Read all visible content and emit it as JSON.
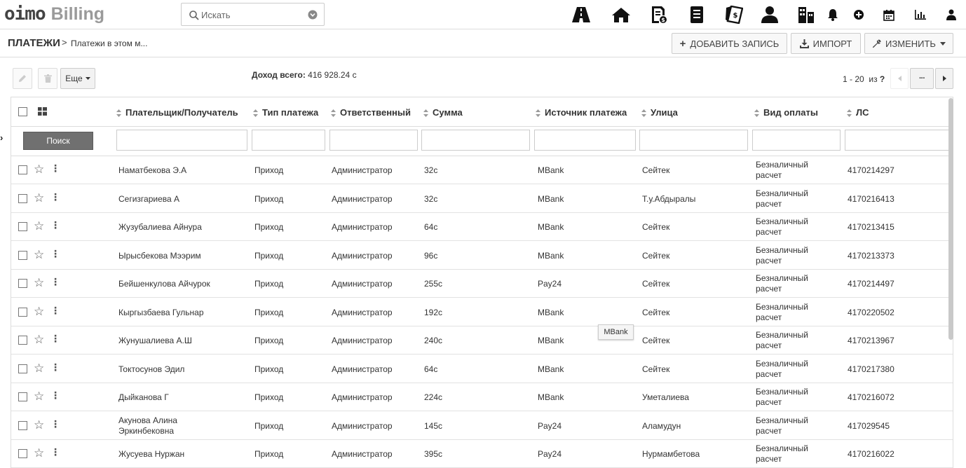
{
  "app": {
    "logo_main": "oimo",
    "logo_sub": "Billing"
  },
  "search": {
    "placeholder": "Искать"
  },
  "topnav": [
    {
      "name": "road-icon"
    },
    {
      "name": "home-icon"
    },
    {
      "name": "invoice-icon"
    },
    {
      "name": "address-book-icon"
    },
    {
      "name": "payments-icon"
    },
    {
      "name": "user-icon"
    },
    {
      "name": "buildings-icon"
    },
    {
      "name": "bell-icon"
    },
    {
      "name": "plus-circle-icon"
    },
    {
      "name": "calendar-icon"
    },
    {
      "name": "bar-chart-icon"
    },
    {
      "name": "user-menu-icon"
    }
  ],
  "breadcrumb": {
    "root": "ПЛАТЕЖИ",
    "separator": ">",
    "leaf": "Платежи в этом м..."
  },
  "actions": {
    "add": "ДОБАВИТЬ ЗАПИСЬ",
    "import": "ИМПОРТ",
    "edit": "ИЗМЕНИТЬ"
  },
  "toolbar": {
    "more": "Еще",
    "income_label": "Доход всего:",
    "income_value": "416 928.24 с"
  },
  "pager": {
    "range": "1 - 20",
    "of": "из",
    "total": "?",
    "more": "···"
  },
  "columns": [
    "Плательщик/Получатель",
    "Тип платежа",
    "Ответственный",
    "Сумма",
    "Источник платежа",
    "Улица",
    "Вид оплаты",
    "ЛС"
  ],
  "filter": {
    "search_button": "Поиск"
  },
  "rows": [
    {
      "payer": "Наматбекова Э.А",
      "type": "Приход",
      "resp": "Администратор",
      "sum": "32с",
      "source": "MBank",
      "street": "Сейтек",
      "pay1": "Безналичный",
      "pay2": "расчет",
      "ls": "4170214297"
    },
    {
      "payer": "Сегизгариева А",
      "type": "Приход",
      "resp": "Администратор",
      "sum": "32с",
      "source": "MBank",
      "street": "Т.у.Абдыралы",
      "pay1": "Безналичный",
      "pay2": "расчет",
      "ls": "4170216413"
    },
    {
      "payer": "Жузубалиева Айнура",
      "type": "Приход",
      "resp": "Администратор",
      "sum": "64с",
      "source": "MBank",
      "street": "Сейтек",
      "pay1": "Безналичный",
      "pay2": "расчет",
      "ls": "4170213415"
    },
    {
      "payer": "Ырысбекова Мээрим",
      "type": "Приход",
      "resp": "Администратор",
      "sum": "96с",
      "source": "MBank",
      "street": "Сейтек",
      "pay1": "Безналичный",
      "pay2": "расчет",
      "ls": "4170213373"
    },
    {
      "payer": "Бейшенкулова Айчурок",
      "type": "Приход",
      "resp": "Администратор",
      "sum": "255с",
      "source": "Pay24",
      "street": "Сейтек",
      "pay1": "Безналичный",
      "pay2": "расчет",
      "ls": "4170214497"
    },
    {
      "payer": "Кыргызбаева Гульнар",
      "type": "Приход",
      "resp": "Администратор",
      "sum": "192с",
      "source": "MBank",
      "street": "Сейтек",
      "pay1": "Безналичный",
      "pay2": "расчет",
      "ls": "4170220502"
    },
    {
      "payer": "Жунушалиева А.Ш",
      "type": "Приход",
      "resp": "Администратор",
      "sum": "240с",
      "source": "MBank",
      "street": "Сейтек",
      "pay1": "Безналичный",
      "pay2": "расчет",
      "ls": "4170213967"
    },
    {
      "payer": "Токтосунов Эдил",
      "type": "Приход",
      "resp": "Администратор",
      "sum": "64с",
      "source": "MBank",
      "street": "Сейтек",
      "pay1": "Безналичный",
      "pay2": "расчет",
      "ls": "4170217380"
    },
    {
      "payer": "Дыйканова Г",
      "type": "Приход",
      "resp": "Администратор",
      "sum": "224с",
      "source": "MBank",
      "street": "Уметалиева",
      "pay1": "Безналичный",
      "pay2": "расчет",
      "ls": "4170216072"
    },
    {
      "payer": "Акунова Алина",
      "payer2": "Эркинбековна",
      "type": "Приход",
      "resp": "Администратор",
      "sum": "145с",
      "source": "Pay24",
      "street": "Аламудун",
      "pay1": "Безналичный",
      "pay2": "расчет",
      "ls": "417029545"
    },
    {
      "payer": "Жусуева Нуржан",
      "type": "Приход",
      "resp": "Администратор",
      "sum": "395с",
      "source": "Pay24",
      "street": "Нурмамбетова",
      "pay1": "Безналичный",
      "pay2": "расчет",
      "ls": "4170216022"
    }
  ],
  "tooltip": "MBank",
  "colors": {
    "search_button": "#707070",
    "border": "#dddddd"
  }
}
